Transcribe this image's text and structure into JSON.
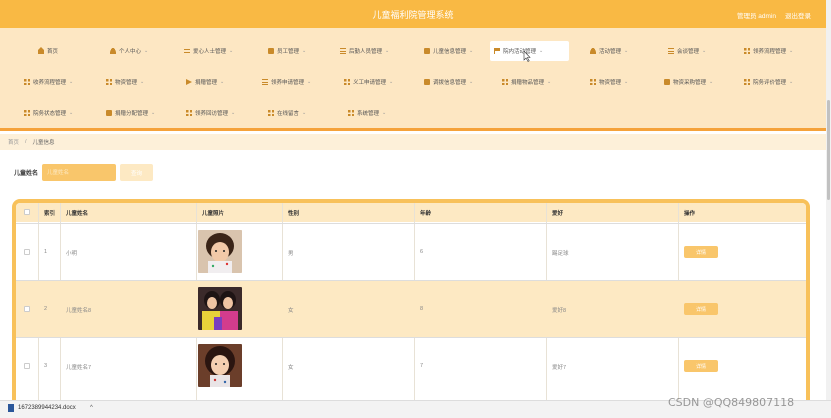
{
  "header": {
    "title": "儿童福利院管理系统",
    "welcome": "管理员 admin",
    "logout": "退出登录",
    "bg_color": "#f9b944"
  },
  "nav": {
    "items": [
      {
        "label": "首页",
        "icon": "home-icon"
      },
      {
        "label": "个人中心",
        "icon": "user-icon"
      },
      {
        "label": "爱心人士管理",
        "icon": "sliders-icon"
      },
      {
        "label": "员工管理",
        "icon": "box-icon"
      },
      {
        "label": "后勤人员管理",
        "icon": "list-icon"
      },
      {
        "label": "儿童信息管理",
        "icon": "box-icon"
      },
      {
        "label": "院内活动管理",
        "icon": "flag-icon",
        "active": true
      },
      {
        "label": "活动管理",
        "icon": "user-icon"
      },
      {
        "label": "会谈管理",
        "icon": "list-icon"
      },
      {
        "label": "领养流程管理",
        "icon": "grid-icon"
      },
      {
        "label": "收养流程管理",
        "icon": "grid-icon"
      },
      {
        "label": "物资管理",
        "icon": "grid-icon"
      },
      {
        "label": "捐赠管理",
        "icon": "plane-icon"
      },
      {
        "label": "领养申请管理",
        "icon": "list-icon"
      },
      {
        "label": "义工申请管理",
        "icon": "grid-icon"
      },
      {
        "label": "调拨信息管理",
        "icon": "box-icon"
      },
      {
        "label": "捐赠物品管理",
        "icon": "grid-icon"
      },
      {
        "label": "物资管理",
        "icon": "grid-icon"
      },
      {
        "label": "物资采购管理",
        "icon": "box-icon"
      },
      {
        "label": "院务评价管理",
        "icon": "grid-icon"
      },
      {
        "label": "院务状态管理",
        "icon": "grid-icon"
      },
      {
        "label": "捐赠分配管理",
        "icon": "box-icon"
      },
      {
        "label": "领养回访管理",
        "icon": "grid-icon"
      },
      {
        "label": "在线留言",
        "icon": "grid-icon"
      },
      {
        "label": "系统管理",
        "icon": "grid-icon"
      }
    ]
  },
  "breadcrumb": {
    "home": "首页",
    "separator": "/",
    "current": "儿童信息"
  },
  "search": {
    "label": "儿童姓名",
    "placeholder": "儿童姓名",
    "button": "查询"
  },
  "table": {
    "columns": [
      "索引",
      "儿童姓名",
      "儿童照片",
      "性别",
      "年龄",
      "爱好",
      "操作"
    ],
    "rows": [
      {
        "index": "1",
        "name": "小明",
        "gender": "男",
        "age": "6",
        "hobby": "踢足球",
        "action": "详情"
      },
      {
        "index": "2",
        "name": "儿童姓名8",
        "gender": "女",
        "age": "8",
        "hobby": "爱好8",
        "action": "详情"
      },
      {
        "index": "3",
        "name": "儿童姓名7",
        "gender": "女",
        "age": "7",
        "hobby": "爱好7",
        "action": "详情"
      }
    ]
  },
  "taskbar": {
    "download_file": "1672389944234.docx",
    "watermark": "CSDN @QQ849807118"
  },
  "colors": {
    "accent": "#f9b944",
    "nav_bg": "#fde7c3",
    "button": "#f9c66b",
    "divider": "#f5a23a"
  }
}
